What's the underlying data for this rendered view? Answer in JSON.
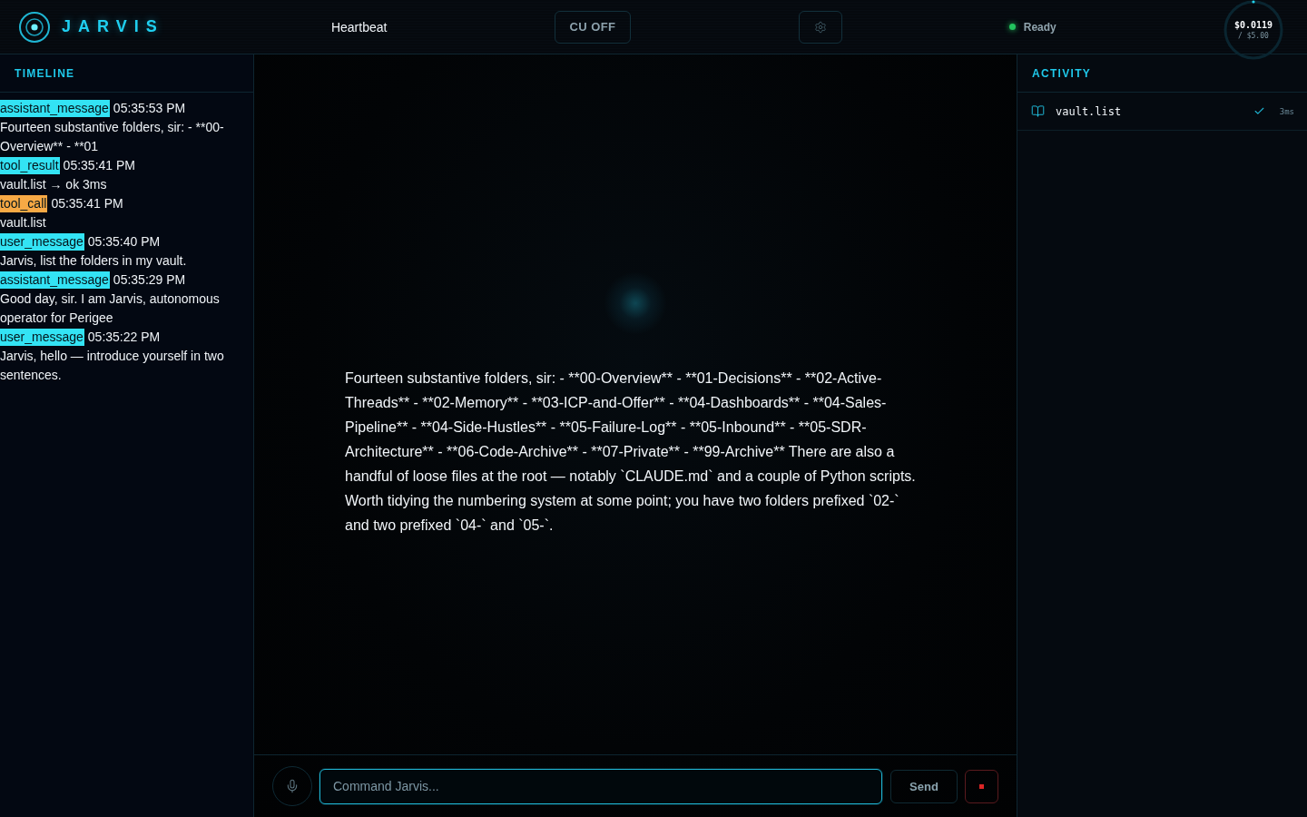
{
  "header": {
    "logo": "JARVIS",
    "title": "Heartbeat",
    "cu_toggle": {
      "label": "CU OFF",
      "on": false
    },
    "status": {
      "label": "Ready",
      "online": true
    },
    "cost": {
      "spent": "$0.0119",
      "budget": "/ $5.00"
    }
  },
  "timeline": {
    "title": "TIMELINE",
    "entries": [
      {
        "type": "assistant_message",
        "color": "#33e3f4",
        "time": "05:35:53 PM",
        "text": "Fourteen substantive folders, sir: - **00-Overview** - **01"
      },
      {
        "type": "tool_result",
        "color": "#33e3f4",
        "time": "05:35:41 PM",
        "text": "vault.list → ok 3ms"
      },
      {
        "type": "tool_call",
        "color": "#f7a945",
        "time": "05:35:41 PM",
        "text": "vault.list"
      },
      {
        "type": "user_message",
        "color": "#33e3f4",
        "time": "05:35:40 PM",
        "text": "Jarvis, list the folders in my vault."
      },
      {
        "type": "assistant_message",
        "color": "#33e3f4",
        "time": "05:35:29 PM",
        "text": "Good day, sir. I am Jarvis, autonomous operator for Perigee"
      },
      {
        "type": "user_message",
        "color": "#33e3f4",
        "time": "05:35:22 PM",
        "text": "Jarvis, hello — introduce yourself in two sentences."
      }
    ]
  },
  "conversation": {
    "message": "Fourteen substantive folders, sir: - **00-Overview** - **01-Decisions** - **02-Active-Threads** - **02-Memory** - **03-ICP-and-Offer** - **04-Dashboards** - **04-Sales-Pipeline** - **04-Side-Hustles** - **05-Failure-Log** - **05-Inbound** - **05-SDR-Architecture** - **06-Code-Archive** - **07-Private** - **99-Archive** There are also a handful of loose files at the root — notably `CLAUDE.md` and a couple of Python scripts. Worth tidying the numbering system at some point; you have two folders prefixed `02-` and two prefixed `04-` and `05-`.",
    "input": {
      "placeholder": "Command Jarvis..."
    },
    "send_button": "Send"
  },
  "activity": {
    "title": "ACTIVITY",
    "items": [
      {
        "tool": "vault.list",
        "succeeded": true,
        "duration": "3ms"
      }
    ]
  }
}
